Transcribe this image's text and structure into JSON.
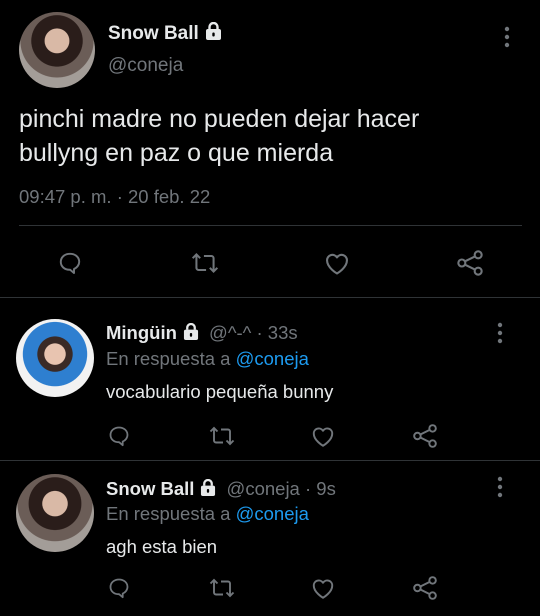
{
  "main_tweet": {
    "display_name": "Snow Ball",
    "handle": "@coneja",
    "text_line1": "pinchi madre no pueden dejar hacer",
    "text_line2": "bullyng en paz o que mierda",
    "timestamp": "09:47 p. m. · 20 feb. 22"
  },
  "replies": [
    {
      "display_name": "Mingüin",
      "handle": "@^-^",
      "time": " · 33s",
      "reply_prefix": "En respuesta a ",
      "reply_to": "@coneja",
      "text": "vocabulario pequeña bunny"
    },
    {
      "display_name": "Snow Ball",
      "handle": "@coneja",
      "time": " · 9s",
      "reply_prefix": "En respuesta a ",
      "reply_to": "@coneja",
      "text": "agh esta bien"
    }
  ],
  "icons": [
    "comment-icon",
    "retweet-icon",
    "like-icon",
    "share-icon",
    "lock-icon",
    "more-icon"
  ],
  "colors": {
    "background": "#000000",
    "text": "#e7e9ea",
    "muted": "#71767b",
    "link": "#1d9bf0",
    "divider": "#2f3336"
  }
}
